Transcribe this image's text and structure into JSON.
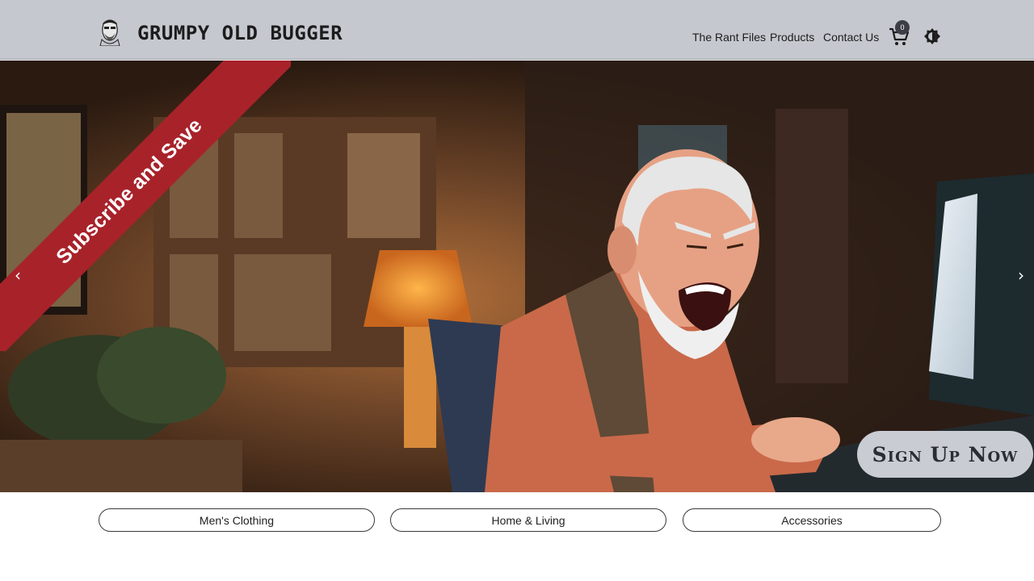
{
  "header": {
    "site_title": "GRUMPY OLD BUGGER",
    "nav": [
      {
        "label": "The Rant Files"
      },
      {
        "label": "Products"
      },
      {
        "label": "Contact Us"
      }
    ],
    "cart_count": "0",
    "icons": {
      "logo": "grumpy-face-logo-icon",
      "cart": "cart-icon",
      "theme": "brightness-icon"
    }
  },
  "hero": {
    "ribbon_text": "Subscribe and Save",
    "signup_label": "Sign Up Now",
    "prev_icon": "‹",
    "next_icon": "›",
    "colors": {
      "ribbon": "#a8222a",
      "signup_bg": "#c9ccd2"
    }
  },
  "categories": [
    {
      "label": "Men's Clothing"
    },
    {
      "label": "Home & Living"
    },
    {
      "label": "Accessories"
    }
  ]
}
